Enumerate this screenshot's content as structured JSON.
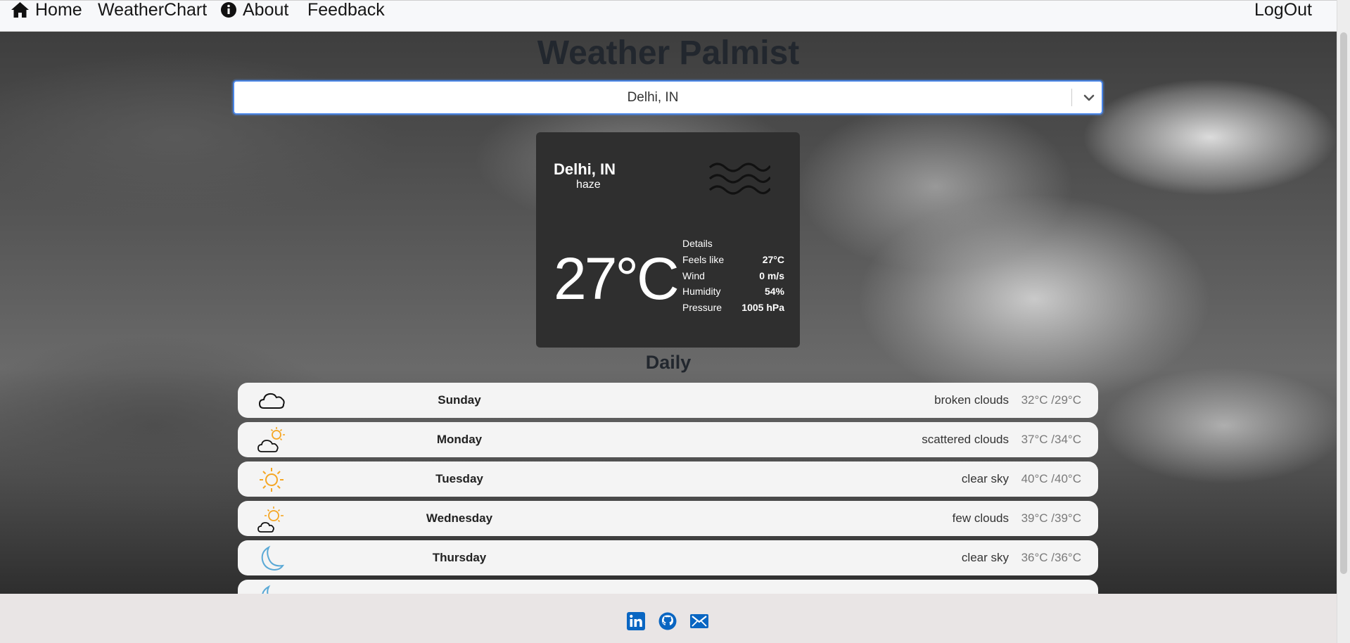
{
  "nav": {
    "home": "Home",
    "weatherchart": "WeatherChart",
    "about": "About",
    "feedback": "Feedback",
    "logout": "LogOut"
  },
  "app_title": "Weather Palmist",
  "search": {
    "selected": "Delhi, IN"
  },
  "current": {
    "city": "Delhi, IN",
    "description": "haze",
    "icon": "haze-icon",
    "temp": "27°C",
    "details_label": "Details",
    "details": [
      {
        "label": "Feels like",
        "value": "27°C"
      },
      {
        "label": "Wind",
        "value": "0 m/s"
      },
      {
        "label": "Humidity",
        "value": "54%"
      },
      {
        "label": "Pressure",
        "value": "1005 hPa"
      }
    ]
  },
  "daily_title": "Daily",
  "daily": [
    {
      "day": "Sunday",
      "condition": "broken clouds",
      "temps": "32°C /29°C",
      "icon": "cloud-icon"
    },
    {
      "day": "Monday",
      "condition": "scattered clouds",
      "temps": "37°C /34°C",
      "icon": "sun-cloud-icon"
    },
    {
      "day": "Tuesday",
      "condition": "clear sky",
      "temps": "40°C /40°C",
      "icon": "sun-icon"
    },
    {
      "day": "Wednesday",
      "condition": "few clouds",
      "temps": "39°C /39°C",
      "icon": "sun-cloud-icon"
    },
    {
      "day": "Thursday",
      "condition": "clear sky",
      "temps": "36°C /36°C",
      "icon": "moon-icon"
    }
  ],
  "colors": {
    "accent": "#0a66c2",
    "card": "#2f2f2f",
    "sun": "#f5a623",
    "moon": "#5aa9d6"
  }
}
